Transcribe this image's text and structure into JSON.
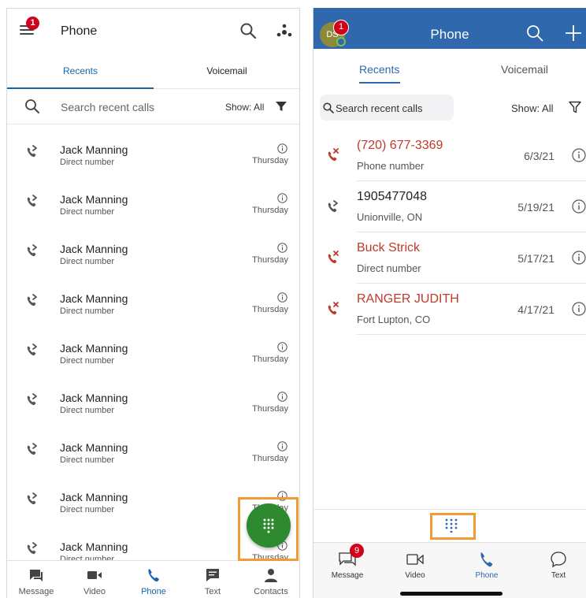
{
  "left": {
    "header": {
      "title": "Phone",
      "menu_badge": "1"
    },
    "tabs": [
      {
        "label": "Recents"
      },
      {
        "label": "Voicemail"
      }
    ],
    "search": {
      "placeholder": "Search recent calls",
      "show_label": "Show: All"
    },
    "rows": [
      {
        "name": "Jack Manning",
        "detail": "Direct number",
        "day": "Thursday"
      },
      {
        "name": "Jack Manning",
        "detail": "Direct number",
        "day": "Thursday"
      },
      {
        "name": "Jack Manning",
        "detail": "Direct number",
        "day": "Thursday"
      },
      {
        "name": "Jack Manning",
        "detail": "Direct number",
        "day": "Thursday"
      },
      {
        "name": "Jack Manning",
        "detail": "Direct number",
        "day": "Thursday"
      },
      {
        "name": "Jack Manning",
        "detail": "Direct number",
        "day": "Thursday"
      },
      {
        "name": "Jack Manning",
        "detail": "Direct number",
        "day": "Thursday"
      },
      {
        "name": "Jack Manning",
        "detail": "Direct number",
        "day": "Thursday"
      },
      {
        "name": "Jack Manning",
        "detail": "Direct number",
        "day": "Thursday"
      }
    ],
    "nav": [
      {
        "label": "Message",
        "icon": "message-icon"
      },
      {
        "label": "Video",
        "icon": "video-icon"
      },
      {
        "label": "Phone",
        "icon": "phone-icon"
      },
      {
        "label": "Text",
        "icon": "text-icon"
      },
      {
        "label": "Contacts",
        "icon": "contacts-icon"
      }
    ],
    "colors": {
      "accent": "#1565a8",
      "fab": "#2e8a2e",
      "highlight": "#f39a32",
      "badge": "#d0021b"
    }
  },
  "right": {
    "header": {
      "title": "Phone",
      "avatar_initials": "DS",
      "avatar_badge": "1"
    },
    "tabs": [
      {
        "label": "Recents"
      },
      {
        "label": "Voicemail"
      }
    ],
    "search": {
      "placeholder": "Search recent calls",
      "show_label": "Show: All"
    },
    "rows": [
      {
        "name": "(720) 677-3369",
        "detail": "Phone number",
        "date": "6/3/21",
        "missed": true
      },
      {
        "name": "1905477048",
        "detail": "Unionville, ON",
        "date": "5/19/21",
        "missed": false
      },
      {
        "name": "Buck Strick",
        "detail": "Direct number",
        "date": "5/17/21",
        "missed": true
      },
      {
        "name": "RANGER JUDITH",
        "detail": "Fort Lupton, CO",
        "date": "4/17/21",
        "missed": true
      }
    ],
    "nav": [
      {
        "label": "Message",
        "icon": "message-icon",
        "badge": "9"
      },
      {
        "label": "Video",
        "icon": "video-icon"
      },
      {
        "label": "Phone",
        "icon": "phone-icon"
      },
      {
        "label": "Text",
        "icon": "text-icon"
      }
    ],
    "colors": {
      "header": "#2f68ad",
      "missed": "#c0392b",
      "highlight": "#f39a32"
    }
  }
}
